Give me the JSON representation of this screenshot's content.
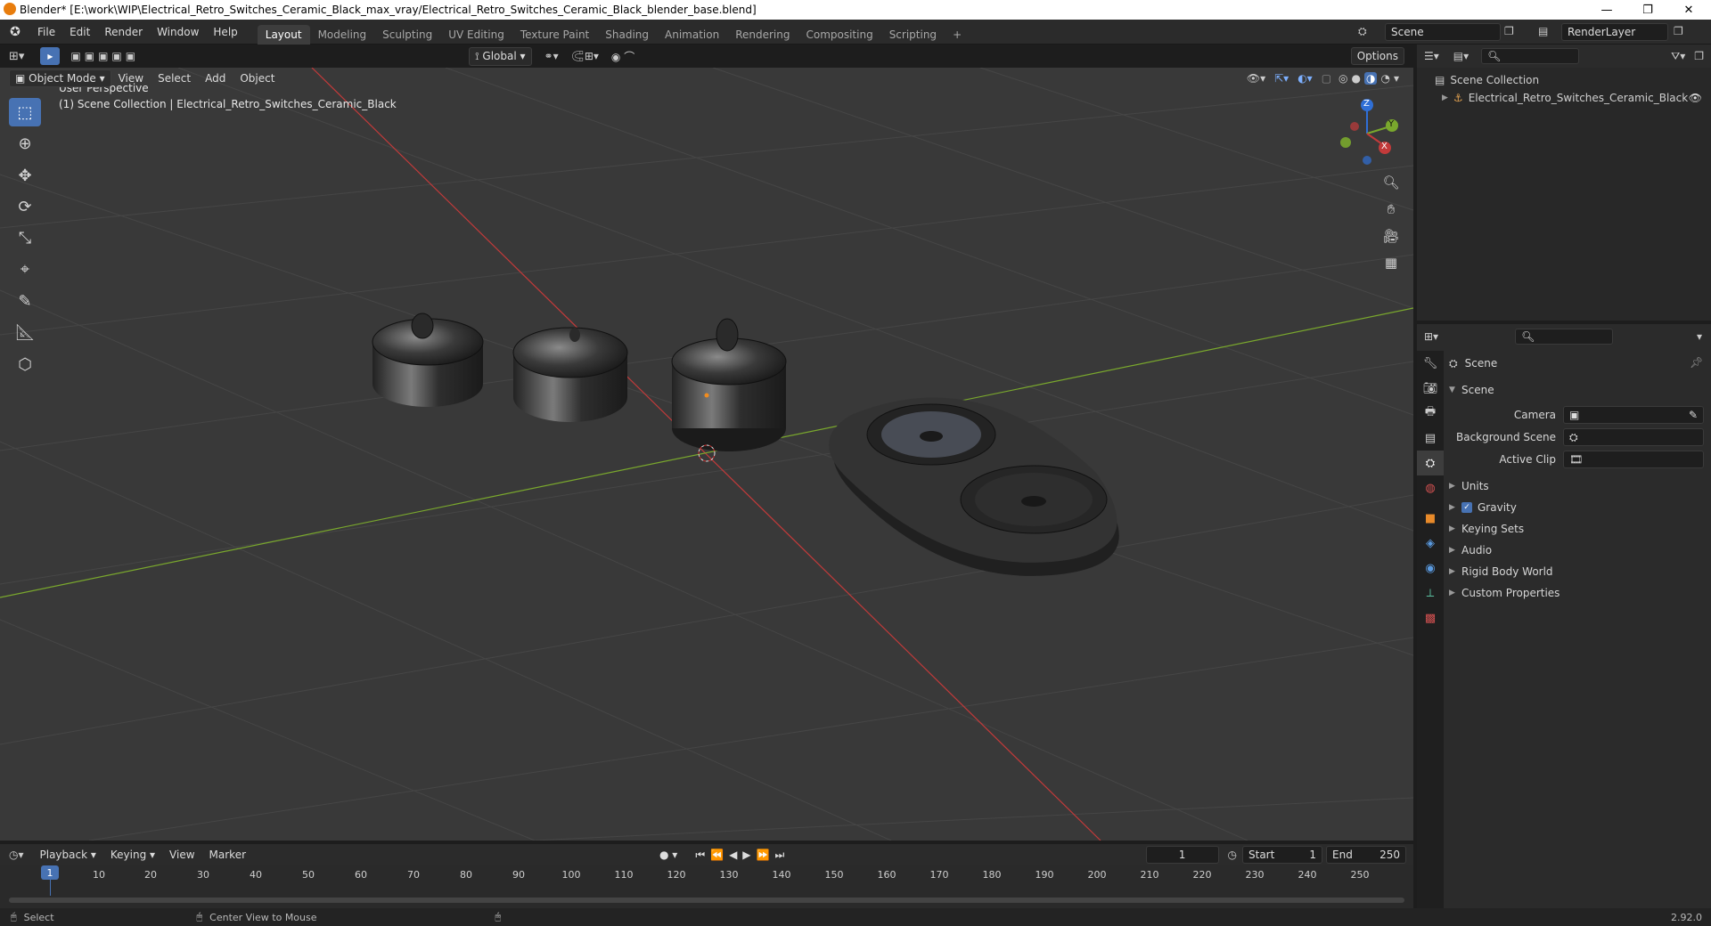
{
  "window": {
    "title": "Blender* [E:\\work\\WIP\\Electrical_Retro_Switches_Ceramic_Black_max_vray/Electrical_Retro_Switches_Ceramic_Black_blender_base.blend]",
    "minimize": "—",
    "restore": "❐",
    "close": "✕"
  },
  "menubar": {
    "items": [
      "File",
      "Edit",
      "Render",
      "Window",
      "Help"
    ],
    "workspaces": [
      "Layout",
      "Modeling",
      "Sculpting",
      "UV Editing",
      "Texture Paint",
      "Shading",
      "Animation",
      "Rendering",
      "Compositing",
      "Scripting"
    ],
    "active_workspace": "Layout",
    "add_tab": "+",
    "scene": "Scene",
    "render_layer": "RenderLayer"
  },
  "viewport": {
    "mode": "Object Mode",
    "menus": [
      "View",
      "Select",
      "Add",
      "Object"
    ],
    "transform_orientation": "Global",
    "options": "Options",
    "info_line1": "User Perspective",
    "info_line2": "(1) Scene Collection | Electrical_Retro_Switches_Ceramic_Black",
    "gizmo_axes": [
      "Z",
      "Y",
      "X"
    ],
    "colors": {
      "bg": "#393939",
      "grid": "#4a4a4a",
      "x_axis": "#c23a3a",
      "y_axis": "#7aa82d"
    }
  },
  "outliner": {
    "root": "Scene Collection",
    "child": "Electrical_Retro_Switches_Ceramic_Black"
  },
  "properties": {
    "context": "Scene",
    "section": "Scene",
    "fields": [
      {
        "label": "Camera",
        "value": ""
      },
      {
        "label": "Background Scene",
        "value": ""
      },
      {
        "label": "Active Clip",
        "value": ""
      }
    ],
    "panels": [
      {
        "label": "Units",
        "checkbox": false
      },
      {
        "label": "Gravity",
        "checkbox": true
      },
      {
        "label": "Keying Sets",
        "checkbox": false
      },
      {
        "label": "Audio",
        "checkbox": false
      },
      {
        "label": "Rigid Body World",
        "checkbox": false
      },
      {
        "label": "Custom Properties",
        "checkbox": false
      }
    ]
  },
  "timeline": {
    "menus": [
      "Playback",
      "Keying",
      "View",
      "Marker"
    ],
    "current_frame": "1",
    "start_label": "Start",
    "start": "1",
    "end_label": "End",
    "end": "250",
    "ticks": [
      "1",
      "10",
      "20",
      "30",
      "40",
      "50",
      "60",
      "70",
      "80",
      "90",
      "100",
      "110",
      "120",
      "130",
      "140",
      "150",
      "160",
      "170",
      "180",
      "190",
      "200",
      "210",
      "220",
      "230",
      "240",
      "250"
    ]
  },
  "statusbar": {
    "left": "Select",
    "middle": "Center View to Mouse",
    "version": "2.92.0"
  }
}
